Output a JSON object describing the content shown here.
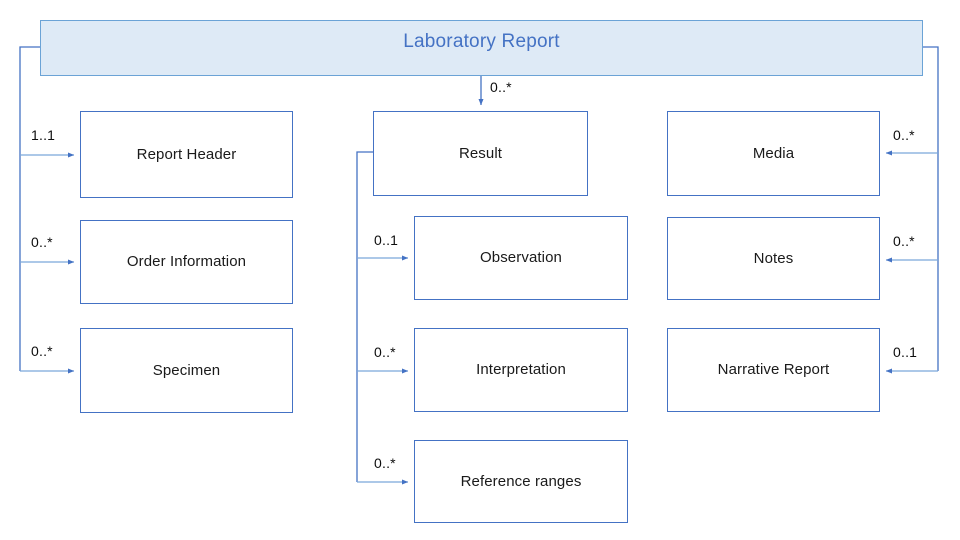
{
  "diagram": {
    "title": "Laboratory Report",
    "root": {
      "id": "laboratory-report",
      "label": "Laboratory Report"
    },
    "nodes": [
      {
        "id": "report-header",
        "label": "Report Header",
        "column": "left",
        "row": 1
      },
      {
        "id": "order-information",
        "label": "Order Information",
        "column": "left",
        "row": 2
      },
      {
        "id": "specimen",
        "label": "Specimen",
        "column": "left",
        "row": 3
      },
      {
        "id": "result",
        "label": "Result",
        "column": "middle",
        "row": 1
      },
      {
        "id": "observation",
        "label": "Observation",
        "column": "middle",
        "row": 2
      },
      {
        "id": "interpretation",
        "label": "Interpretation",
        "column": "middle",
        "row": 3
      },
      {
        "id": "reference-ranges",
        "label": "Reference ranges",
        "column": "middle",
        "row": 4
      },
      {
        "id": "media",
        "label": "Media",
        "column": "right",
        "row": 1
      },
      {
        "id": "notes",
        "label": "Notes",
        "column": "right",
        "row": 2
      },
      {
        "id": "narrative-report",
        "label": "Narrative Report",
        "column": "right",
        "row": 3
      }
    ],
    "edges": [
      {
        "id": "edge-root-result",
        "from": "laboratory-report",
        "to": "result",
        "multiplicity": "0..*"
      },
      {
        "id": "edge-root-report-header",
        "from": "laboratory-report",
        "to": "report-header",
        "multiplicity": "1..1"
      },
      {
        "id": "edge-root-order-info",
        "from": "laboratory-report",
        "to": "order-information",
        "multiplicity": "0..*"
      },
      {
        "id": "edge-root-specimen",
        "from": "laboratory-report",
        "to": "specimen",
        "multiplicity": "0..*"
      },
      {
        "id": "edge-result-observation",
        "from": "result",
        "to": "observation",
        "multiplicity": "0..1"
      },
      {
        "id": "edge-result-interpretation",
        "from": "result",
        "to": "interpretation",
        "multiplicity": "0..*"
      },
      {
        "id": "edge-result-refranges",
        "from": "result",
        "to": "reference-ranges",
        "multiplicity": "0..*"
      },
      {
        "id": "edge-root-media",
        "from": "laboratory-report",
        "to": "media",
        "multiplicity": "0..*"
      },
      {
        "id": "edge-root-notes",
        "from": "laboratory-report",
        "to": "notes",
        "multiplicity": "0..*"
      },
      {
        "id": "edge-root-narrative",
        "from": "laboratory-report",
        "to": "narrative-report",
        "multiplicity": "0..1"
      }
    ],
    "colors": {
      "root_fill": "#deeaf6",
      "root_border": "#6ba3d6",
      "root_text": "#4472c4",
      "node_border": "#4472c4",
      "node_fill": "#ffffff",
      "node_text": "#1a1a1a",
      "connector": "#4472c4",
      "connector_light": "#7ba7db",
      "background": "#ffffff"
    }
  }
}
